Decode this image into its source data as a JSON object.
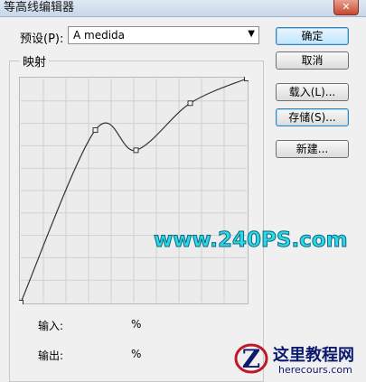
{
  "window": {
    "title": "等高线编辑器",
    "close_glyph": "✕"
  },
  "preset": {
    "label": "预设(P):",
    "value": "A medida",
    "arrow_icon": "caret-down-icon"
  },
  "buttons": {
    "ok": "确定",
    "cancel": "取消",
    "load": "载入(L)...",
    "save": "存储(S)...",
    "new": "新建..."
  },
  "mapping": {
    "group_label": "映射",
    "input_label": "输入:",
    "output_label": "输出:",
    "input_unit": "%",
    "output_unit": "%"
  },
  "curve": {
    "points_percent": [
      {
        "input": 0,
        "output": 0
      },
      {
        "input": 33,
        "output": 77
      },
      {
        "input": 51,
        "output": 68
      },
      {
        "input": 75,
        "output": 89
      },
      {
        "input": 100,
        "output": 100
      }
    ]
  },
  "watermark": {
    "center": "www.240PS.com",
    "site_cn": "这里教程网",
    "site_url": "herecours.com",
    "logo_letter": "Z"
  }
}
